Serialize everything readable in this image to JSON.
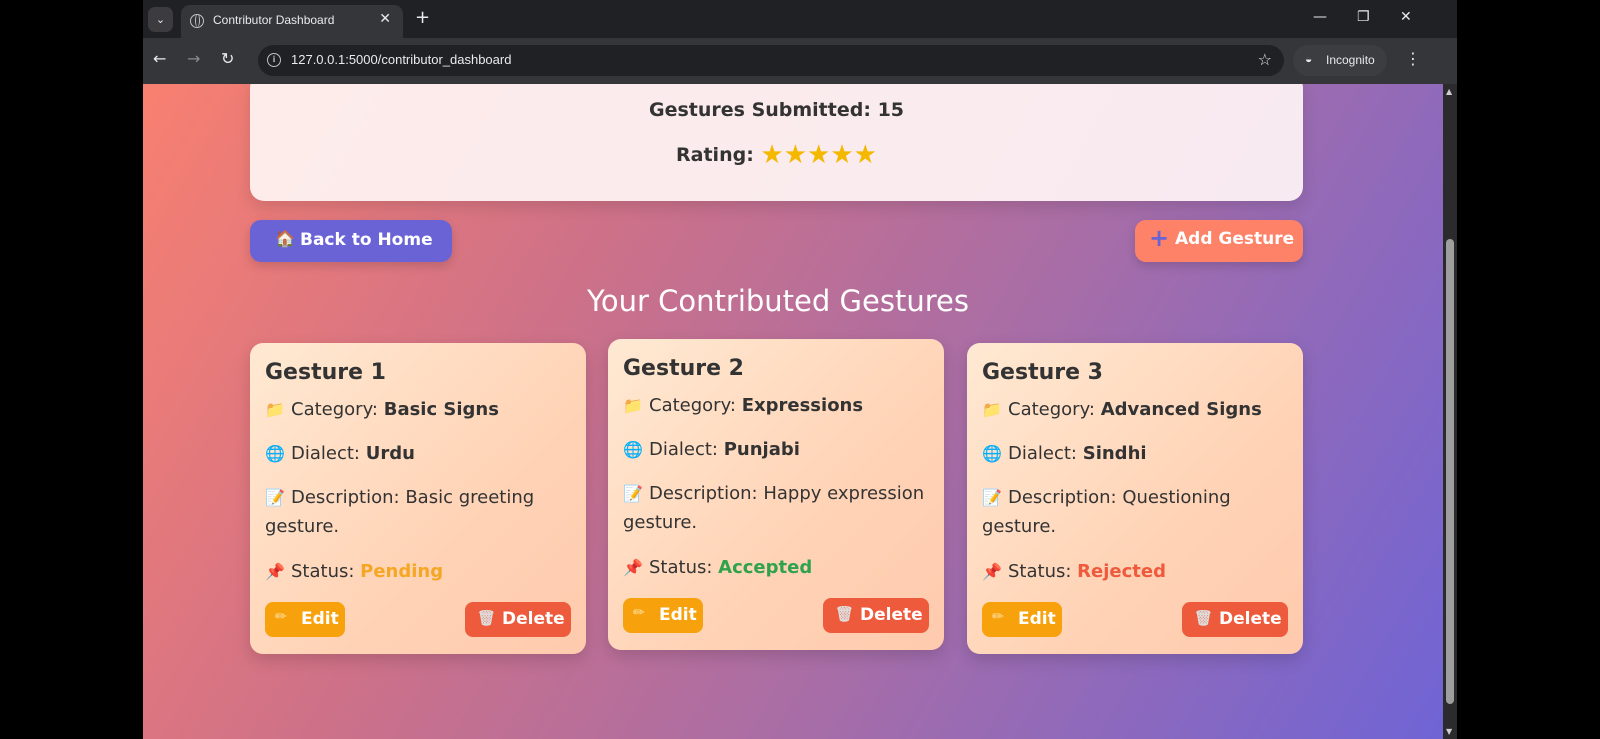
{
  "browser": {
    "tab_title": "Contributor Dashboard",
    "url": "127.0.0.1:5000/contributor_dashboard",
    "incognito_label": "Incognito"
  },
  "stats": {
    "gestures_label": "Gestures Submitted:",
    "gestures_value": "15",
    "rating_label": "Rating:",
    "rating_stars": "★★★★★",
    "rating_value": 5
  },
  "actions": {
    "home_icon": "🏠",
    "home_label": "Back to Home",
    "add_icon": "+",
    "add_label": "Add Gesture"
  },
  "section_title": "Your Contributed Gestures",
  "labels": {
    "category": "Category:",
    "dialect": "Dialect:",
    "description": "Description:",
    "status": "Status:",
    "edit": "Edit",
    "delete": "Delete"
  },
  "icons": {
    "folder": "📁",
    "globe": "🌐",
    "memo": "📝",
    "pin": "📌",
    "pencil": "✏",
    "trash": "🗑"
  },
  "gestures": [
    {
      "title": "Gesture 1",
      "category": "Basic Signs",
      "dialect": "Urdu",
      "description": "Basic greeting gesture.",
      "status": "Pending",
      "status_color": "#f5a623"
    },
    {
      "title": "Gesture 2",
      "category": "Expressions",
      "dialect": "Punjabi",
      "description": "Happy expression gesture.",
      "status": "Accepted",
      "status_color": "#2fa24c"
    },
    {
      "title": "Gesture 3",
      "category": "Advanced Signs",
      "dialect": "Sindhi",
      "description": "Questioning gesture.",
      "status": "Rejected",
      "status_color": "#ef5a3c"
    }
  ],
  "colors": {
    "primary": "#6a63d6",
    "accent": "#fd8268",
    "edit": "#f7a10d",
    "delete": "#ee5a3c"
  }
}
